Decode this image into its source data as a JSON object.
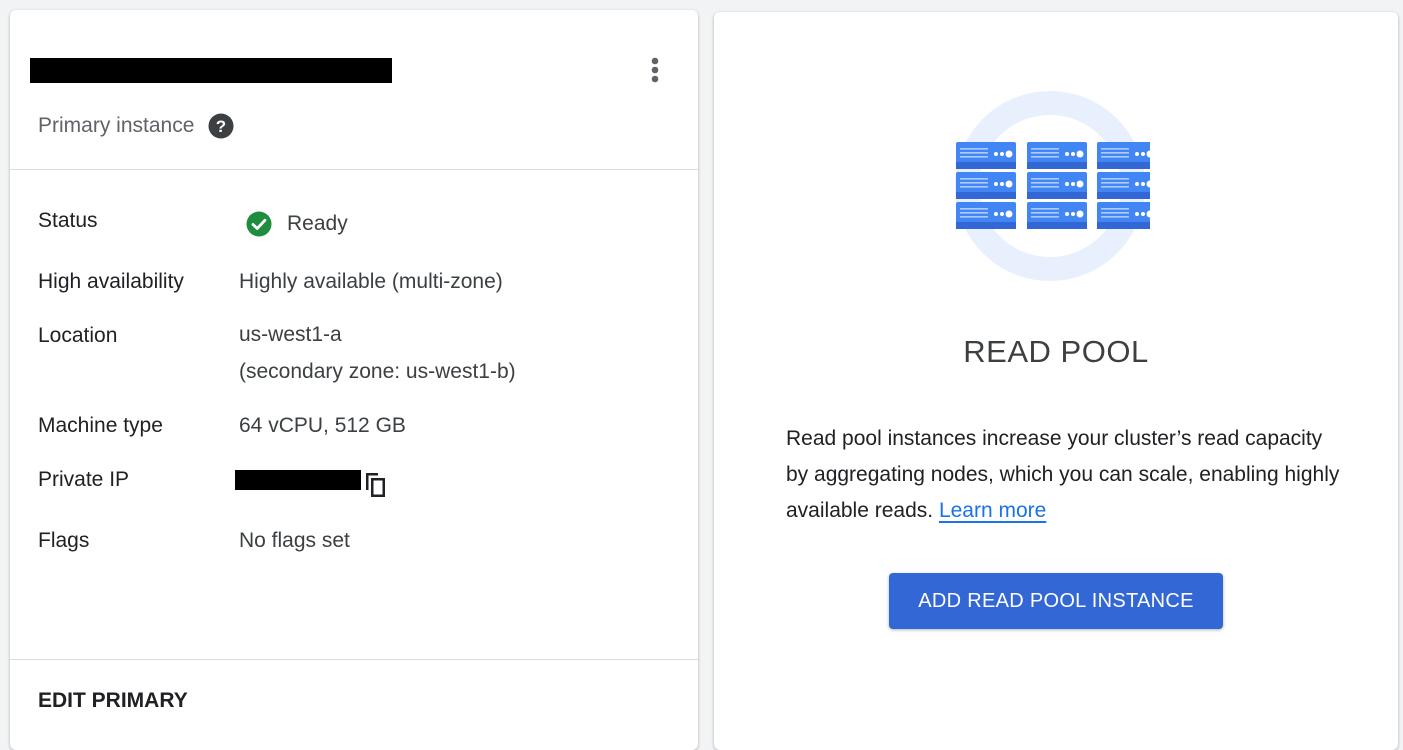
{
  "primary_card": {
    "subtitle": "Primary instance",
    "details": {
      "status_label": "Status",
      "status_value": "Ready",
      "ha_label": "High availability",
      "ha_value": "Highly available (multi-zone)",
      "location_label": "Location",
      "location_value": "us-west1-a",
      "location_secondary": "(secondary zone: us-west1-b)",
      "machine_label": "Machine type",
      "machine_value": "64 vCPU, 512 GB",
      "ip_label": "Private IP",
      "flags_label": "Flags",
      "flags_value": "No flags set"
    },
    "edit_label": "EDIT PRIMARY",
    "icons": {
      "more": "more-vert-icon",
      "help": "help-icon",
      "status": "check-circle-icon",
      "copy": "copy-icon"
    }
  },
  "read_pool_card": {
    "title": "READ POOL",
    "description": "Read pool instances increase your cluster’s read capacity by aggregating nodes, which you can scale, enabling highly available reads.",
    "learn_more": "Learn more",
    "add_button": "ADD READ POOL INSTANCE"
  },
  "colors": {
    "accent": "#3367d6",
    "link": "#1a73e8",
    "success": "#1e8e3e"
  }
}
